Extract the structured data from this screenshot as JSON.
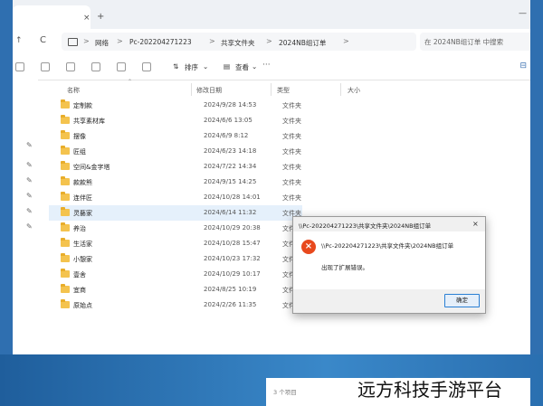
{
  "tabbar": {
    "close_glyph": "×",
    "new_tab_glyph": "+",
    "window_controls": "—"
  },
  "nav": {
    "up_glyph": "↑",
    "refresh_glyph": "C"
  },
  "address": {
    "crumbs": [
      "网络",
      "Pc-202204271223",
      "共享文件夹",
      "2024NB组订单"
    ],
    "separator": ">"
  },
  "search": {
    "placeholder": "在 2024NB组订单 中搜索"
  },
  "toolbar": {
    "sort_label": "排序",
    "view_label": "查看",
    "more_glyph": "···",
    "details_glyph": "⊟"
  },
  "columns": {
    "name": "名称",
    "date": "修改日期",
    "type": "类型",
    "size": "大小"
  },
  "files": [
    {
      "name": "定制款",
      "date": "2024/9/28 14:53",
      "type": "文件夹"
    },
    {
      "name": "共享素材库",
      "date": "2024/6/6 13:05",
      "type": "文件夹"
    },
    {
      "name": "摆像",
      "date": "2024/6/9 8:12",
      "type": "文件夹"
    },
    {
      "name": "匠组",
      "date": "2024/6/23 14:18",
      "type": "文件夹"
    },
    {
      "name": "空间&金字塔",
      "date": "2024/7/22 14:34",
      "type": "文件夹"
    },
    {
      "name": "款款熊",
      "date": "2024/9/15 14:25",
      "type": "文件夹"
    },
    {
      "name": "连伴匠",
      "date": "2024/10/28 14:01",
      "type": "文件夹"
    },
    {
      "name": "灵藝家",
      "date": "2024/6/14 11:32",
      "type": "文件夹"
    },
    {
      "name": "养治",
      "date": "2024/10/29 20:38",
      "type": "文件夹"
    },
    {
      "name": "生活家",
      "date": "2024/10/28 15:47",
      "type": "文件夹"
    },
    {
      "name": "小憩家",
      "date": "2024/10/23 17:32",
      "type": "文件夹"
    },
    {
      "name": "壹舍",
      "date": "2024/10/29 10:17",
      "type": "文件夹"
    },
    {
      "name": "宜商",
      "date": "2024/8/25 10:19",
      "type": "文件夹"
    },
    {
      "name": "原始点",
      "date": "2024/2/26 11:35",
      "type": "文件夹"
    }
  ],
  "status": {
    "item_count": "3 个项目"
  },
  "dialog": {
    "title": "\\\\Pc-202204271223\\共享文件夹\\2024NB组订单",
    "close_glyph": "×",
    "icon_glyph": "×",
    "path": "\\\\Pc-202204271223\\共享文件夹\\2024NB组订单",
    "message": "出现了扩展错误。",
    "ok_label": "确定",
    "error_color": "#e8491d"
  },
  "watermark": "远方科技手游平台"
}
